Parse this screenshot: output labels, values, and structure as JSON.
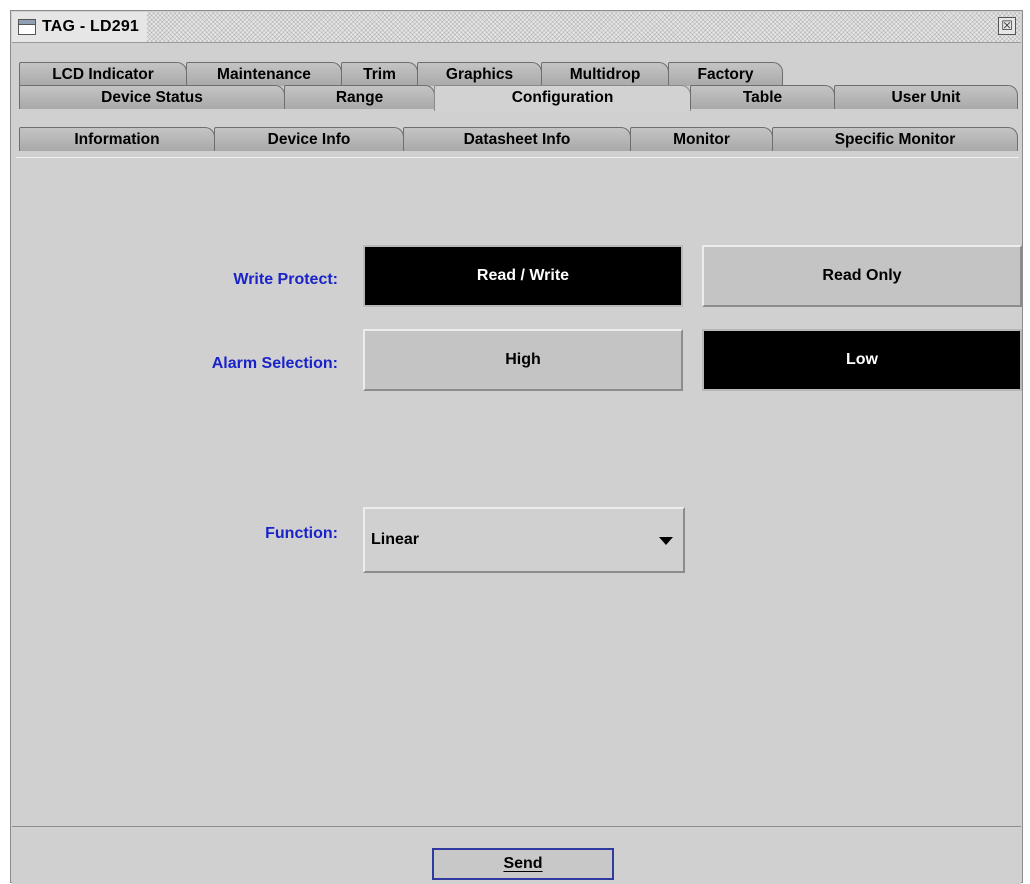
{
  "window": {
    "title": "TAG - LD291",
    "close_label": "☒"
  },
  "tabs": {
    "row1": [
      {
        "label": "LCD Indicator"
      },
      {
        "label": "Maintenance"
      },
      {
        "label": "Trim"
      },
      {
        "label": "Graphics"
      },
      {
        "label": "Multidrop"
      },
      {
        "label": "Factory"
      }
    ],
    "row2": [
      {
        "label": "Device Status"
      },
      {
        "label": "Range"
      },
      {
        "label": "Configuration",
        "selected": true
      },
      {
        "label": "Table"
      },
      {
        "label": "User Unit"
      }
    ],
    "row3": [
      {
        "label": "Information"
      },
      {
        "label": "Device Info"
      },
      {
        "label": "Datasheet Info"
      },
      {
        "label": "Monitor"
      },
      {
        "label": "Specific Monitor"
      }
    ]
  },
  "form": {
    "write_protect": {
      "label": "Write Protect:",
      "options": [
        {
          "label": "Read / Write",
          "selected": true
        },
        {
          "label": "Read Only",
          "selected": false
        }
      ]
    },
    "alarm_selection": {
      "label": "Alarm Selection:",
      "options": [
        {
          "label": "High",
          "selected": false
        },
        {
          "label": "Low",
          "selected": true
        }
      ]
    },
    "function": {
      "label": "Function:",
      "value": "Linear"
    }
  },
  "footer": {
    "send_label": "Send"
  },
  "colors": {
    "label_blue": "#1a23c8",
    "panel_gray": "#d0d0d0",
    "tab_gray": "#a9a9a9",
    "selected_black": "#000000"
  }
}
